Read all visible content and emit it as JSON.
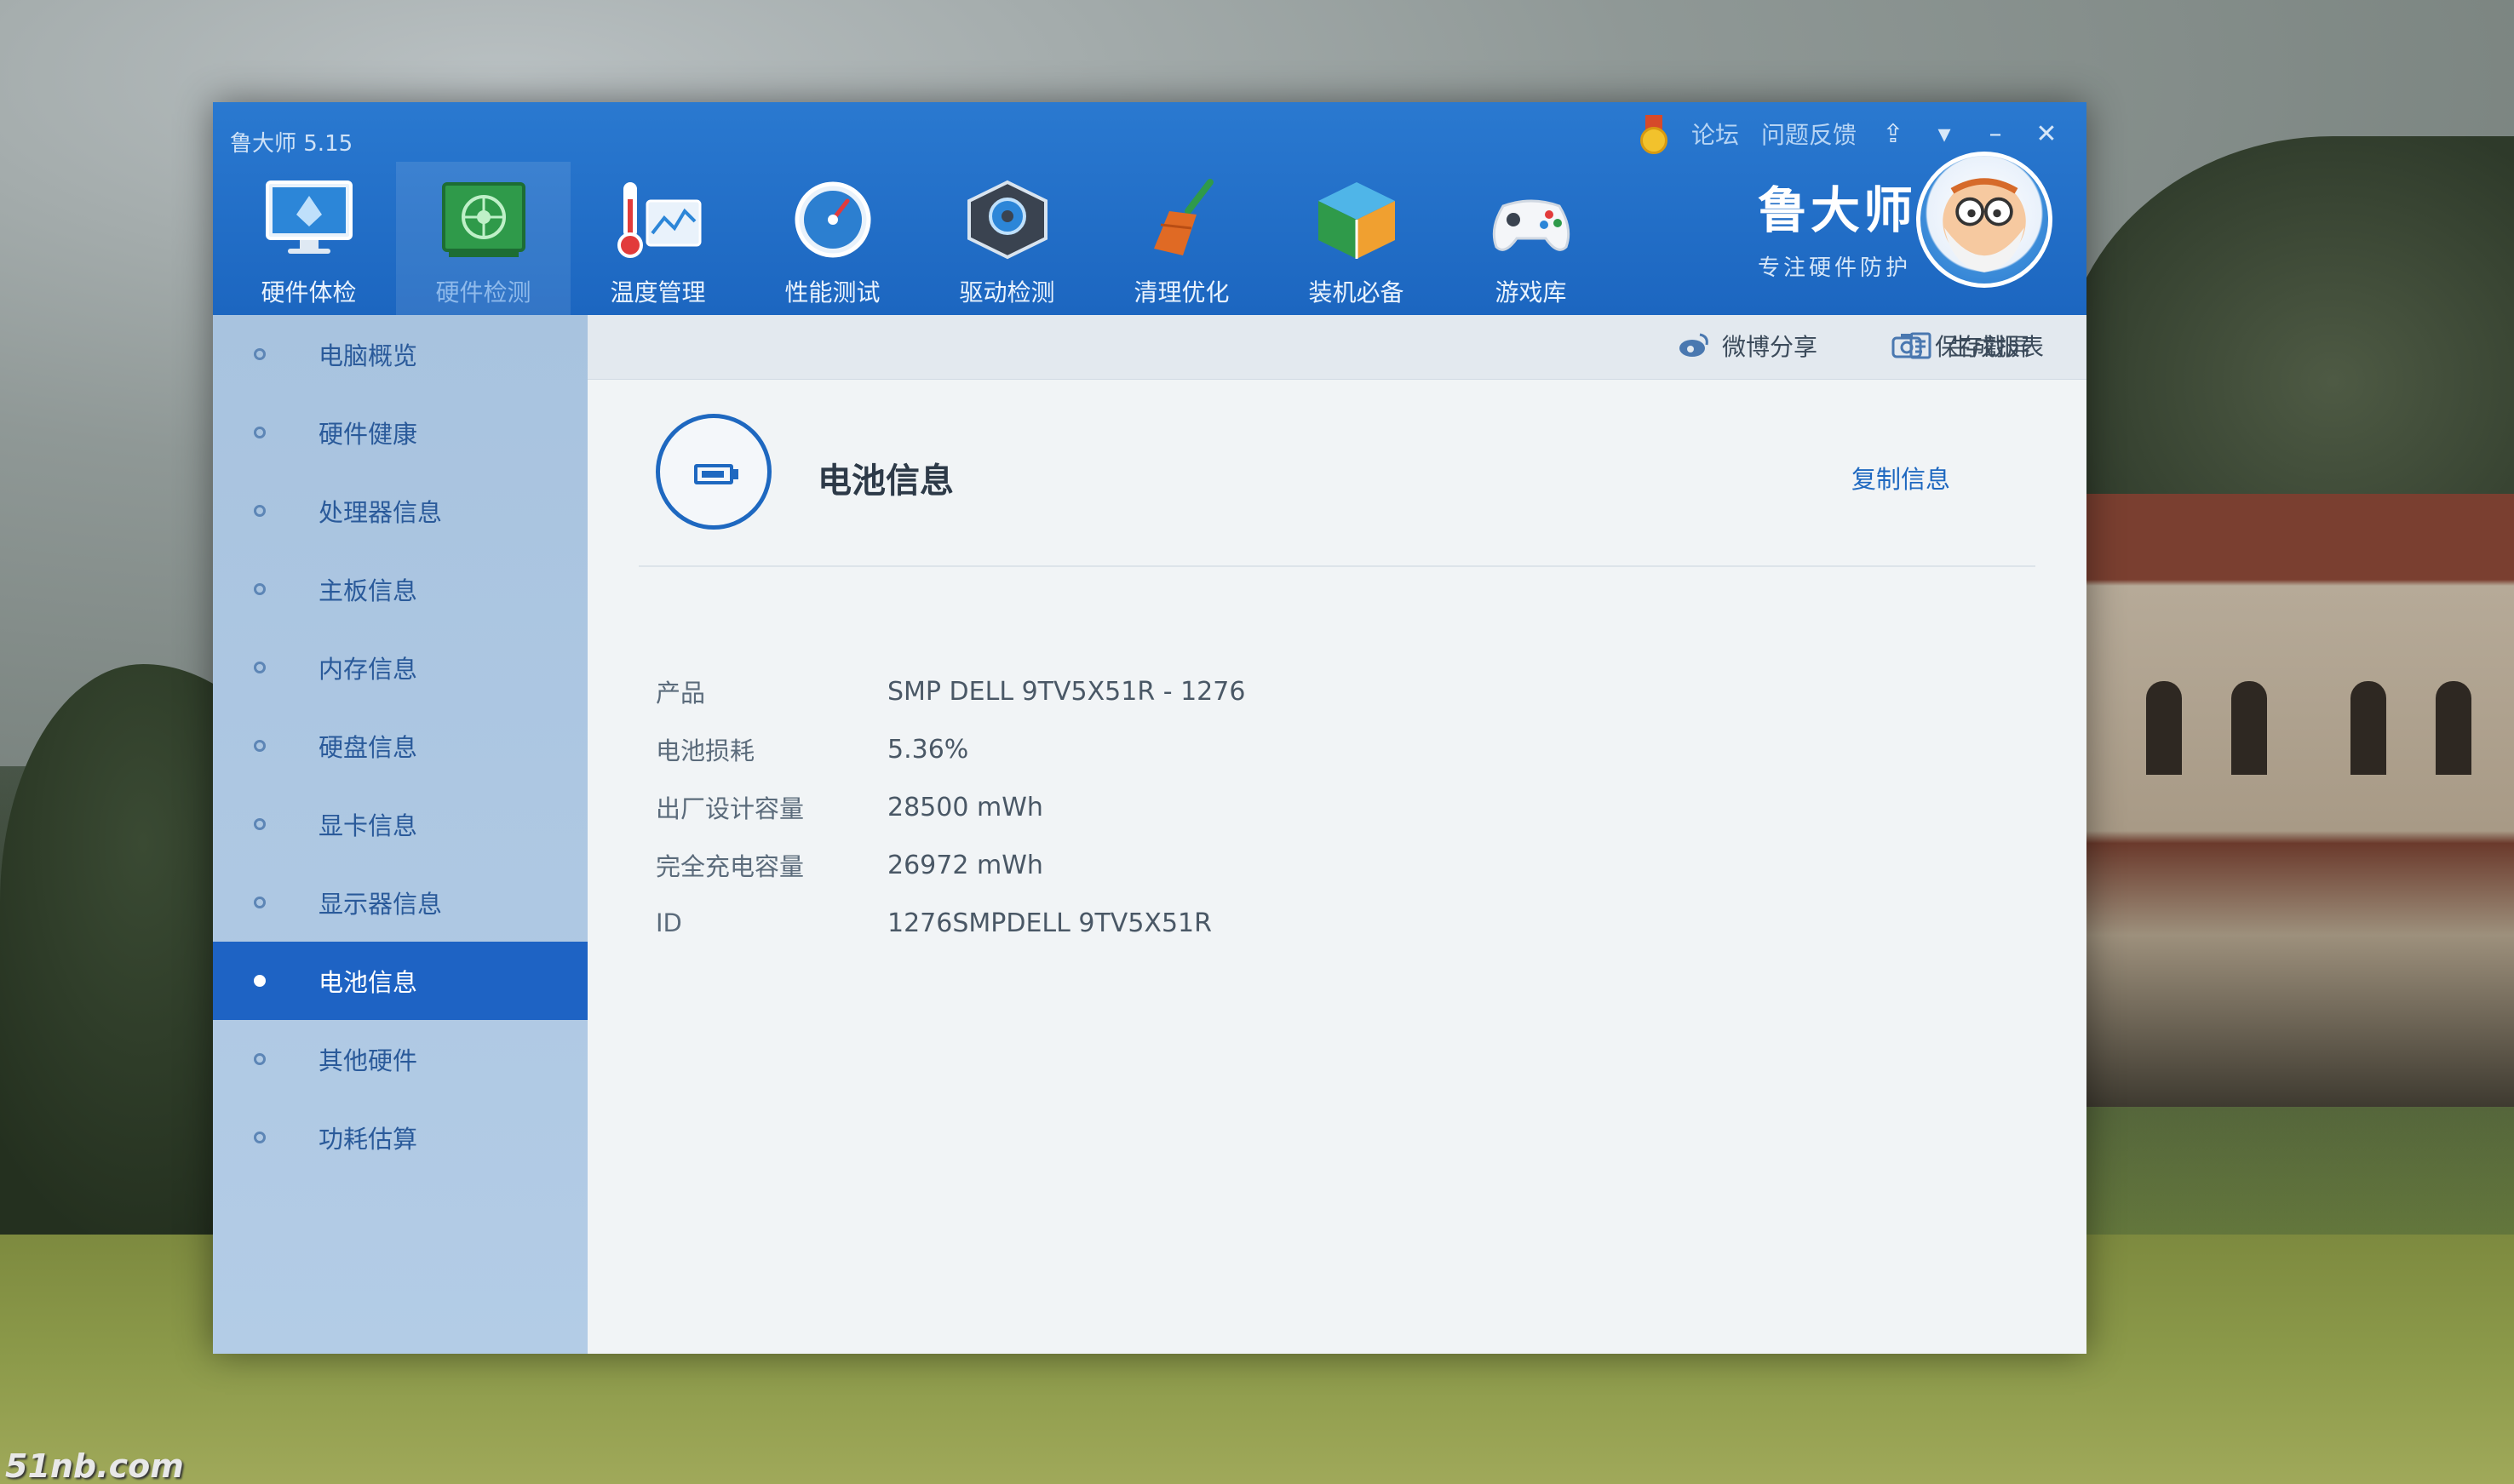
{
  "window": {
    "app_title": "鲁大师 5.15",
    "top_links": [
      "论坛",
      "问题反馈"
    ],
    "controls": [
      "⇪",
      "▾",
      "–",
      "✕"
    ]
  },
  "toolbar": {
    "items": [
      {
        "label": "硬件体检",
        "icon": "monitor-icon"
      },
      {
        "label": "硬件检测",
        "icon": "circuit-board-icon"
      },
      {
        "label": "温度管理",
        "icon": "thermometer-icon"
      },
      {
        "label": "性能测试",
        "icon": "speedometer-icon"
      },
      {
        "label": "驱动检测",
        "icon": "gear-cube-icon"
      },
      {
        "label": "清理优化",
        "icon": "broom-icon"
      },
      {
        "label": "装机必备",
        "icon": "package-box-icon"
      },
      {
        "label": "游戏库",
        "icon": "gamepad-icon"
      }
    ],
    "active_index": 1
  },
  "brand": {
    "name": "鲁大师",
    "slogan": "专注硬件防护"
  },
  "sidebar": {
    "items": [
      "电脑概览",
      "硬件健康",
      "处理器信息",
      "主板信息",
      "内存信息",
      "硬盘信息",
      "显卡信息",
      "显示器信息",
      "电池信息",
      "其他硬件",
      "功耗估算"
    ],
    "active_index": 8
  },
  "actions": {
    "share": "微博分享",
    "screenshot": "保存截屏",
    "report": "生成报表"
  },
  "panel": {
    "title": "电池信息",
    "copy_label": "复制信息",
    "rows": [
      {
        "key": "产品",
        "value": "SMP DELL 9TV5X51R - 1276"
      },
      {
        "key": "电池损耗",
        "value": "5.36%"
      },
      {
        "key": "出厂设计容量",
        "value": "28500 mWh"
      },
      {
        "key": "完全充电容量",
        "value": "26972 mWh"
      },
      {
        "key": "ID",
        "value": "1276SMPDELL 9TV5X51R"
      }
    ]
  },
  "watermark": "51nb.com",
  "colors": {
    "title_bar": "#1c66c0",
    "sidebar_active": "#1e63c4",
    "accent": "#1e68c0"
  }
}
